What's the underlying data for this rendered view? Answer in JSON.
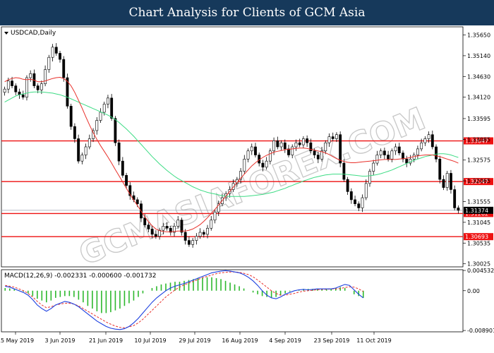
{
  "header": {
    "title": "Chart Analysis for Clients of GCM Asia"
  },
  "watermark": "GCMASIAFOREX.COM",
  "chart_data": {
    "type": "candlestick",
    "symbol_label": "USDCAD,Daily",
    "indicator_label": "MACD(12,26,9) -0.002331 -0.000600 -0.001732",
    "price_axis": {
      "ylim": [
        1.2995,
        1.3585
      ],
      "ticks": [
        "1.35650",
        "1.35140",
        "1.34630",
        "1.34120",
        "1.33595",
        "1.33085",
        "1.32575",
        "1.32065",
        "1.31555",
        "1.31045",
        "1.30535",
        "1.30025"
      ]
    },
    "macd_axis": {
      "ylim": [
        -0.0092,
        0.0047
      ],
      "ticks": [
        "0.004532",
        "0.00",
        "-0.008901"
      ]
    },
    "x_ticks": [
      "15 May 2019",
      "3 Jun 2019",
      "21 Jun 2019",
      "10 Jul 2019",
      "29 Jul 2019",
      "16 Aug 2019",
      "4 Sep 2019",
      "23 Sep 2019",
      "11 Oct 2019"
    ],
    "levels": [
      {
        "value": 1.33047,
        "label": "1.33047"
      },
      {
        "value": 1.32047,
        "label": "1.32047"
      },
      {
        "value": 1.31262,
        "label": "1.31262"
      },
      {
        "value": 1.30693,
        "label": "1.30693"
      }
    ],
    "current_price": {
      "value": 1.3134,
      "label": "1.31374"
    },
    "colors": {
      "bull": "#ffffff",
      "bear": "#000000",
      "ma_fast": "#e8302a",
      "ma_slow": "#3ddc84",
      "level": "#ee1111",
      "macd_main": "#1b3fe0",
      "macd_signal": "#e8302a",
      "macd_hist": "#2db82d"
    },
    "close": [
      1.3432,
      1.3452,
      1.344,
      1.3425,
      1.3418,
      1.3412,
      1.346,
      1.347,
      1.344,
      1.343,
      1.3445,
      1.348,
      1.351,
      1.3535,
      1.352,
      1.3505,
      1.346,
      1.339,
      1.334,
      1.331,
      1.3255,
      1.327,
      1.329,
      1.331,
      1.333,
      1.3355,
      1.3375,
      1.3395,
      1.341,
      1.336,
      1.33,
      1.3255,
      1.322,
      1.3195,
      1.317,
      1.316,
      1.315,
      1.3115,
      1.3098,
      1.3088,
      1.3075,
      1.307,
      1.3085,
      1.3095,
      1.309,
      1.308,
      1.3095,
      1.311,
      1.308,
      1.306,
      1.305,
      1.306,
      1.307,
      1.308,
      1.3075,
      1.309,
      1.311,
      1.313,
      1.315,
      1.3165,
      1.3175,
      1.3185,
      1.32,
      1.321,
      1.323,
      1.326,
      1.328,
      1.329,
      1.327,
      1.325,
      1.324,
      1.3255,
      1.328,
      1.3305,
      1.329,
      1.33,
      1.3285,
      1.327,
      1.329,
      1.33,
      1.3295,
      1.331,
      1.33,
      1.328,
      1.327,
      1.326,
      1.328,
      1.33,
      1.3315,
      1.331,
      1.332,
      1.325,
      1.321,
      1.318,
      1.316,
      1.315,
      1.314,
      1.3165,
      1.32,
      1.323,
      1.325,
      1.327,
      1.328,
      1.327,
      1.326,
      1.328,
      1.329,
      1.3275,
      1.326,
      1.325,
      1.326,
      1.327,
      1.3285,
      1.33,
      1.331,
      1.332,
      1.329,
      1.326,
      1.321,
      1.319,
      1.3225,
      1.3185,
      1.314,
      1.3134
    ],
    "ma_fast": [
      1.345,
      1.3455,
      1.3458,
      1.346,
      1.3459,
      1.3456,
      1.3455,
      1.3456,
      1.3454,
      1.345,
      1.345,
      1.3452,
      1.3455,
      1.3458,
      1.346,
      1.3461,
      1.3458,
      1.3451,
      1.344,
      1.3424,
      1.3405,
      1.3385,
      1.3364,
      1.3344,
      1.3325,
      1.3308,
      1.3293,
      1.3279,
      1.3265,
      1.325,
      1.3234,
      1.3219,
      1.3204,
      1.3188,
      1.3173,
      1.3159,
      1.3146,
      1.3132,
      1.3118,
      1.3106,
      1.3096,
      1.3088,
      1.3084,
      1.3082,
      1.3081,
      1.3081,
      1.3082,
      1.3083,
      1.3083,
      1.3083,
      1.3085,
      1.3088,
      1.3093,
      1.3099,
      1.3107,
      1.3116,
      1.3126,
      1.3136,
      1.3147,
      1.3158,
      1.3169,
      1.318,
      1.3191,
      1.3202,
      1.3213,
      1.3223,
      1.3233,
      1.3243,
      1.3251,
      1.3258,
      1.3264,
      1.3269,
      1.3273,
      1.3277,
      1.3279,
      1.3281,
      1.3283,
      1.3284,
      1.3285,
      1.3286,
      1.3287,
      1.3287,
      1.3286,
      1.3284,
      1.3282,
      1.328,
      1.3278,
      1.3275,
      1.3271,
      1.3266,
      1.3261,
      1.3257,
      1.3254,
      1.3252,
      1.3251,
      1.3251,
      1.3252,
      1.3253,
      1.3254,
      1.3255,
      1.3256,
      1.3257,
      1.3258,
      1.3259,
      1.3259,
      1.3259,
      1.3259,
      1.326,
      1.3261,
      1.3262,
      1.3264,
      1.3266,
      1.3268,
      1.3269,
      1.327,
      1.327,
      1.327,
      1.3268,
      1.3266,
      1.3263,
      1.326,
      1.3257,
      1.3254,
      1.325
    ],
    "ma_slow": [
      1.34,
      1.3405,
      1.341,
      1.3415,
      1.3418,
      1.342,
      1.3422,
      1.3424,
      1.3425,
      1.3425,
      1.3425,
      1.3424,
      1.3423,
      1.3422,
      1.342,
      1.3418,
      1.3415,
      1.3412,
      1.3408,
      1.3404,
      1.34,
      1.3396,
      1.3392,
      1.3388,
      1.3384,
      1.338,
      1.3376,
      1.3372,
      1.3368,
      1.3363,
      1.3357,
      1.335,
      1.3342,
      1.3334,
      1.3325,
      1.3316,
      1.3306,
      1.3296,
      1.3286,
      1.3276,
      1.3266,
      1.3257,
      1.3248,
      1.324,
      1.3232,
      1.3225,
      1.3218,
      1.3212,
      1.3207,
      1.3202,
      1.3197,
      1.3192,
      1.3188,
      1.3184,
      1.3181,
      1.3178,
      1.3176,
      1.3174,
      1.3172,
      1.317,
      1.3169,
      1.3168,
      1.3168,
      1.3168,
      1.3168,
      1.3168,
      1.3169,
      1.317,
      1.3171,
      1.3172,
      1.3173,
      1.3175,
      1.3177,
      1.3179,
      1.3182,
      1.3185,
      1.3188,
      1.3192,
      1.3195,
      1.3199,
      1.3202,
      1.3206,
      1.3209,
      1.3212,
      1.3215,
      1.3217,
      1.3219,
      1.3221,
      1.3222,
      1.3223,
      1.3223,
      1.3223,
      1.3223,
      1.3222,
      1.3221,
      1.322,
      1.3219,
      1.3218,
      1.3218,
      1.3219,
      1.322,
      1.3222,
      1.3224,
      1.3227,
      1.323,
      1.3233,
      1.3237,
      1.3241,
      1.3245,
      1.3249,
      1.3253,
      1.3257,
      1.326,
      1.3263,
      1.3266,
      1.3268,
      1.327,
      1.3272,
      1.3273,
      1.3273,
      1.3272,
      1.327,
      1.3267,
      1.3264
    ],
    "macd_main": [
      0.001,
      0.0008,
      0.0004,
      0.0,
      -0.0004,
      -0.001,
      -0.002,
      -0.0032,
      -0.004,
      -0.0046,
      -0.004,
      -0.0032,
      -0.0028,
      -0.0024,
      -0.0026,
      -0.003,
      -0.0036,
      -0.0044,
      -0.0052,
      -0.006,
      -0.0068,
      -0.0074,
      -0.008,
      -0.0084,
      -0.0086,
      -0.0087,
      -0.0085,
      -0.008,
      -0.0072,
      -0.0062,
      -0.005,
      -0.0038,
      -0.0026,
      -0.0016,
      -0.0008,
      0.0,
      0.0006,
      0.001,
      0.0013,
      0.0016,
      0.002,
      0.0024,
      0.0028,
      0.0032,
      0.0036,
      0.004,
      0.0042,
      0.0044,
      0.0045,
      0.0044,
      0.0042,
      0.004,
      0.0036,
      0.003,
      0.0022,
      0.0012,
      0.0,
      -0.001,
      -0.0016,
      -0.0018,
      -0.0014,
      -0.0008,
      -0.0004,
      0.0,
      0.0002,
      0.0003,
      0.0002,
      0.0003,
      0.0004,
      0.0004,
      0.0004,
      0.0004,
      0.0006,
      0.001,
      0.0014,
      0.0012,
      0.0002,
      -0.0008,
      -0.0016
    ],
    "macd_signal": [
      0.0012,
      0.001,
      0.0008,
      0.0004,
      0.0,
      -0.0006,
      -0.0014,
      -0.0024,
      -0.0032,
      -0.0038,
      -0.0036,
      -0.0032,
      -0.003,
      -0.0028,
      -0.0028,
      -0.003,
      -0.0034,
      -0.004,
      -0.0046,
      -0.0052,
      -0.0058,
      -0.0064,
      -0.007,
      -0.0075,
      -0.0079,
      -0.0082,
      -0.0083,
      -0.0081,
      -0.0078,
      -0.0072,
      -0.0064,
      -0.0054,
      -0.0044,
      -0.0034,
      -0.0024,
      -0.0014,
      -0.0006,
      0.0002,
      0.0008,
      0.0013,
      0.0017,
      0.0021,
      0.0025,
      0.0029,
      0.0032,
      0.0035,
      0.0038,
      0.004,
      0.0041,
      0.0042,
      0.0042,
      0.0041,
      0.0039,
      0.0036,
      0.0031,
      0.0024,
      0.0016,
      0.0008,
      0.0,
      -0.0006,
      -0.001,
      -0.001,
      -0.0008,
      -0.0006,
      -0.0003,
      -0.0001,
      0.0,
      0.0001,
      0.0002,
      0.0003,
      0.0003,
      0.0004,
      0.0004,
      0.0005,
      0.0007,
      0.0009,
      0.0008,
      0.0004,
      -0.0002
    ],
    "macd_hist": [
      0.0006,
      0.0005,
      0.0003,
      0.0001,
      -0.0002,
      -0.0006,
      -0.0012,
      -0.0018,
      -0.0022,
      -0.0026,
      -0.0022,
      -0.0016,
      -0.0014,
      -0.0012,
      -0.0012,
      -0.0014,
      -0.002,
      -0.0026,
      -0.0034,
      -0.004,
      -0.0046,
      -0.005,
      -0.005,
      -0.0048,
      -0.0044,
      -0.004,
      -0.0034,
      -0.0028,
      -0.0022,
      -0.0014,
      -0.0006,
      0.0,
      0.0006,
      0.001,
      0.0014,
      0.0016,
      0.0018,
      0.002,
      0.002,
      0.0022,
      0.0024,
      0.0026,
      0.0028,
      0.003,
      0.003,
      0.003,
      0.0028,
      0.0026,
      0.0022,
      0.0018,
      0.0014,
      0.001,
      0.0005,
      0.0,
      -0.0004,
      -0.0008,
      -0.0012,
      -0.0014,
      -0.0016,
      -0.0014,
      -0.001,
      -0.0006,
      -0.0002,
      0.0,
      0.0002,
      0.0004,
      0.0004,
      0.0004,
      0.0004,
      0.0004,
      0.0004,
      0.0004,
      0.0006,
      0.0008,
      0.0006,
      0.0,
      -0.0008,
      -0.0012,
      -0.0016
    ]
  }
}
